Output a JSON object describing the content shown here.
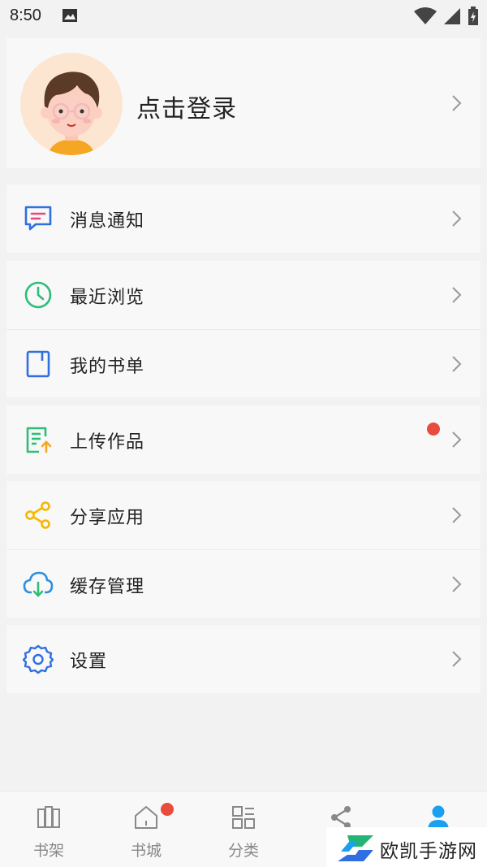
{
  "status_bar": {
    "time": "8:50"
  },
  "profile": {
    "login_label": "点击登录"
  },
  "menu": {
    "messages": "消息通知",
    "recent": "最近浏览",
    "booklist": "我的书单",
    "upload": "上传作品",
    "share": "分享应用",
    "cache": "缓存管理",
    "settings": "设置"
  },
  "tabs": [
    {
      "label": "书架",
      "icon": "bookshelf-icon"
    },
    {
      "label": "书城",
      "icon": "home-icon",
      "badge": true
    },
    {
      "label": "分类",
      "icon": "grid-icon"
    },
    {
      "label": "",
      "icon": "share-icon"
    },
    {
      "label": "",
      "icon": "user-icon",
      "active": true
    }
  ],
  "watermark": {
    "text": "欧凯手游网"
  },
  "colors": {
    "accent": "#1aa0f0",
    "badge": "#e74c3c",
    "background": "#f2f2f2"
  }
}
